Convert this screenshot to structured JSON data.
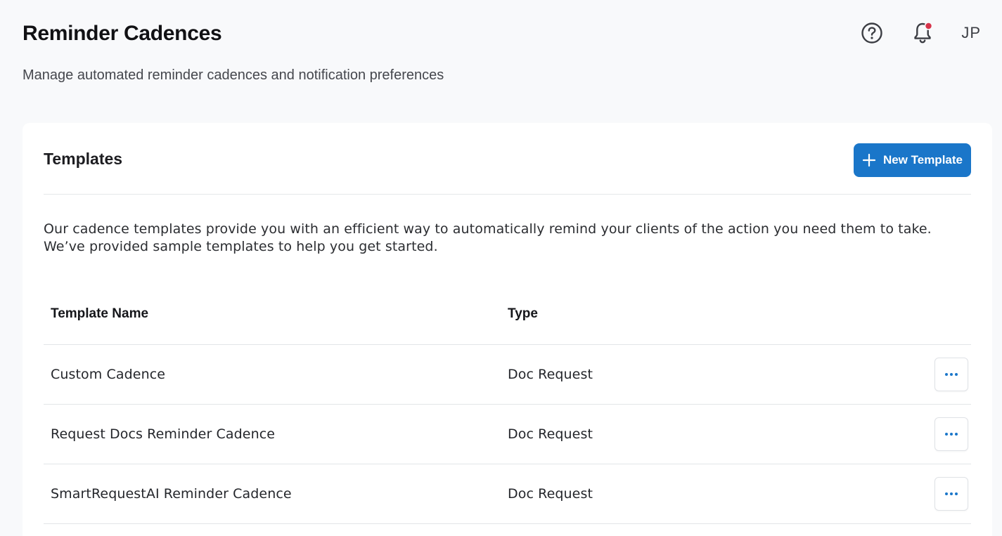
{
  "header": {
    "title": "Reminder Cadences",
    "subtitle": "Manage automated reminder cadences and notification preferences",
    "user_initials": "JP"
  },
  "icons": {
    "help": "help-circle-icon",
    "notifications": "bell-icon",
    "notification_badge": true,
    "new_template": "plus-icon",
    "row_actions": "more-horizontal-icon"
  },
  "colors": {
    "accent": "#1a76c9",
    "badge": "#d6334a",
    "background": "#f8f9fb"
  },
  "templates_card": {
    "title": "Templates",
    "new_button_label": "New Template",
    "description": "Our cadence templates provide you with an efficient way to automatically remind your clients of the action you need them to take. We’ve provided sample templates to help you get started.",
    "columns": {
      "name": "Template Name",
      "type": "Type"
    },
    "rows": [
      {
        "name": "Custom Cadence",
        "type": "Doc Request"
      },
      {
        "name": "Request Docs Reminder Cadence",
        "type": "Doc Request"
      },
      {
        "name": "SmartRequestAI Reminder Cadence",
        "type": "Doc Request"
      }
    ]
  }
}
